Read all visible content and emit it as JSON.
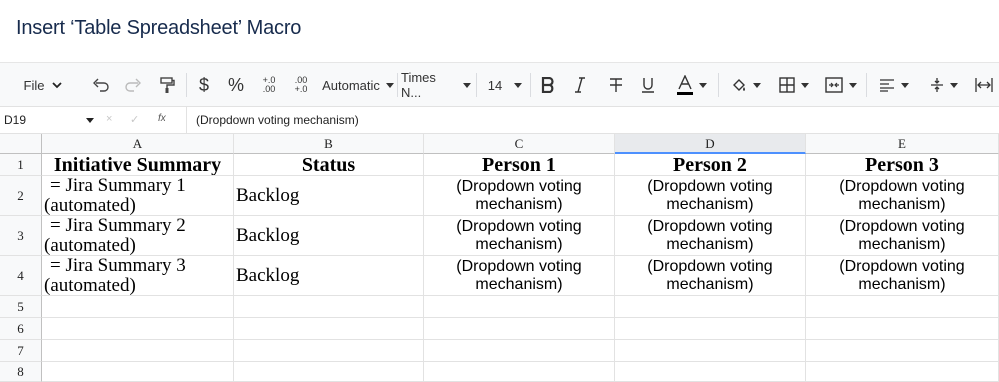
{
  "page": {
    "title": "Insert ‘Table Spreadsheet’ Macro"
  },
  "toolbar": {
    "file_label": "File",
    "format_label": "Automatic",
    "font_label": "Times N...",
    "font_size": "14",
    "decimal_increase": "+.0 .00",
    "decimal_decrease": ".00 +.0",
    "currency_symbol": "$",
    "percent_symbol": "%"
  },
  "formula_bar": {
    "cell_ref": "D19",
    "cancel_glyph": "×",
    "accept_glyph": "✓",
    "fx_label": "fx",
    "value": "(Dropdown voting mechanism)"
  },
  "sheet": {
    "columns": [
      "A",
      "B",
      "C",
      "D",
      "E"
    ],
    "selected_column": "D",
    "rows": [
      "1",
      "2",
      "3",
      "4",
      "5",
      "6",
      "7",
      "8"
    ],
    "header_row": [
      "Initiative Summary",
      "Status",
      "Person 1",
      "Person 2",
      "Person 3"
    ],
    "data_rows": [
      {
        "summary_line1": "= Jira Summary 1",
        "summary_line2": "(automated)",
        "status": "Backlog",
        "p1": "(Dropdown voting mechanism)",
        "p2": "(Dropdown voting mechanism)",
        "p3": "(Dropdown voting mechanism)"
      },
      {
        "summary_line1": "= Jira Summary 2",
        "summary_line2": "(automated)",
        "status": "Backlog",
        "p1": "(Dropdown voting mechanism)",
        "p2": "(Dropdown voting mechanism)",
        "p3": "(Dropdown voting mechanism)"
      },
      {
        "summary_line1": "= Jira Summary 3",
        "summary_line2": "(automated)",
        "status": "Backlog",
        "p1": "(Dropdown voting mechanism)",
        "p2": "(Dropdown voting mechanism)",
        "p3": "(Dropdown voting mechanism)"
      }
    ]
  },
  "colors": {
    "accent": "#4d90fe",
    "title": "#172b4d"
  }
}
